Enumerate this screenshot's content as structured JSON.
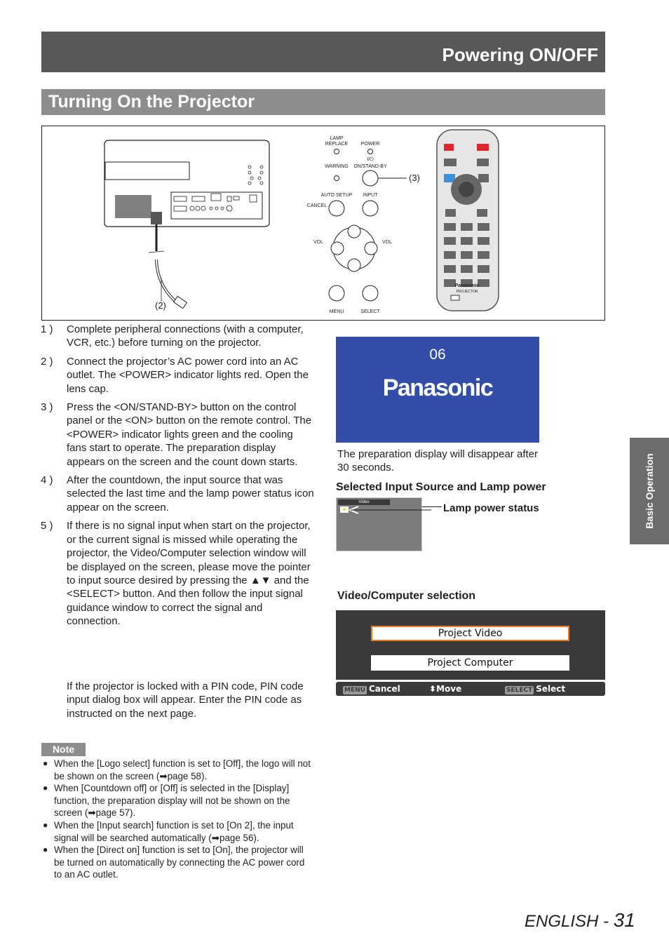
{
  "header": {
    "title": "Powering ON/OFF"
  },
  "section": {
    "title": "Turning On the Projector"
  },
  "figure": {
    "callout_power_cord": "(2)",
    "callout_onstandby": "(3)",
    "control_panel": {
      "lamp_replace": "LAMP\nREPLACE",
      "lamp_1": "LAMP",
      "lamp_2": "REPLACE",
      "power": "POWER",
      "warning": "WARNING",
      "on_standby_symbol": "I/⏻",
      "on_standby": "ON/STAND-BY",
      "auto_setup": "AUTO SETUP",
      "input": "INPUT",
      "cancel": "CANCEL",
      "vol_minus": "VOL",
      "vol_plus": "VOL",
      "menu": "MENU",
      "select": "SELECT"
    },
    "remote": {
      "brand": "Panasonic",
      "model": "PROJECTOR"
    }
  },
  "steps": [
    {
      "num": "1 )",
      "text": "Complete peripheral connections (with a computer, VCR, etc.) before turning on the projector."
    },
    {
      "num": "2 )",
      "text": "Connect the projector’s AC power cord into an AC outlet. The <POWER> indicator lights red. Open the lens cap."
    },
    {
      "num": "3 )",
      "text": "Press the <ON/STAND-BY> button on the control panel or the <ON> button on the remote control. The <POWER> indicator lights green and the cooling fans start to operate. The preparation display appears on the screen and the count down starts."
    },
    {
      "num": "4 )",
      "text": "After the countdown, the input source that was selected the last time and the lamp power status icon appear on the screen."
    },
    {
      "num": "5 )",
      "text": "If there is no signal input when start on the projector, or the current signal is missed while operating the projector, the Video/Computer selection window will be displayed on the screen, please move the pointer to input source desired by pressing the ▲▼ and the <SELECT> button. And then follow the input signal guidance window to correct the signal and connection."
    }
  ],
  "pin_note": "If the projector is locked with a PIN code, PIN code input dialog box will appear. Enter the PIN code as instructed on the next page.",
  "note": {
    "label": "Note",
    "items": [
      "When the [Logo select] function is set to [Off], the logo will not be shown on the screen (➡page 58).",
      "When [Countdown off] or [Off] is selected in the [Display] function, the preparation display will not be shown on the screen (➡page 57).",
      "When the [Input search] function is set to [On 2], the input signal will be searched automatically (➡page 56).",
      "When the [Direct on] function is set to [On], the projector will be turned on automatically by connecting the AC power cord to an AC outlet."
    ]
  },
  "prep_display": {
    "countdown": "06",
    "brand": "Panasonic",
    "caption": "The preparation display will disappear after 30 seconds.",
    "bg_color": "#324ea8"
  },
  "input_lamp": {
    "heading": "Selected Input Source and Lamp power",
    "osd_title": "Video",
    "callout": "Lamp power status"
  },
  "selection": {
    "heading": "Video/Computer selection",
    "options": [
      "Project Video",
      "Project Computer"
    ],
    "active_index": 0,
    "highlight_color": "#ea7b25",
    "footer": {
      "menu_key": "MENU",
      "cancel": "Cancel",
      "move_icon": "⬍",
      "move": "Move",
      "select_key": "SELECT",
      "select": "Select"
    }
  },
  "side_tab": {
    "label": "Basic Operation"
  },
  "footer": {
    "language": "ENGLISH",
    "separator": " - ",
    "page": "31"
  }
}
